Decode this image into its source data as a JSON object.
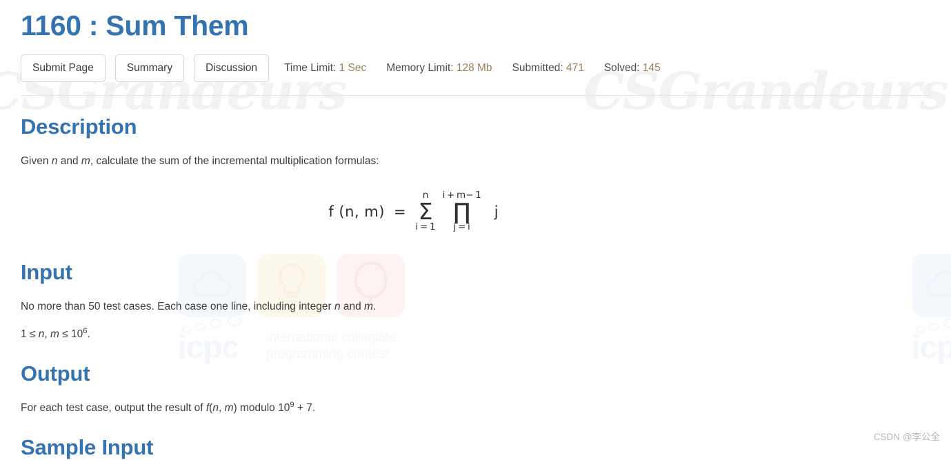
{
  "problem": {
    "title": "1160 : Sum Them"
  },
  "toolbar": {
    "buttons": [
      {
        "label": "Submit Page",
        "name": "submit-page-button"
      },
      {
        "label": "Summary",
        "name": "summary-button"
      },
      {
        "label": "Discussion",
        "name": "discussion-button"
      }
    ]
  },
  "stats": [
    {
      "label": "Time Limit:",
      "value": "1 Sec"
    },
    {
      "label": "Memory Limit:",
      "value": "128 Mb"
    },
    {
      "label": "Submitted:",
      "value": "471"
    },
    {
      "label": "Solved:",
      "value": "145"
    }
  ],
  "sections": {
    "description": {
      "heading": "Description",
      "intro_a": "Given ",
      "intro_var1": "n",
      "intro_b": " and ",
      "intro_var2": "m",
      "intro_c": ", calculate the sum of the incremental multiplication formulas:"
    },
    "input": {
      "heading": "Input",
      "line1_a": "No more than 50 test cases. Each case one line, including integer ",
      "line1_var1": "n",
      "line1_b": " and ",
      "line1_var2": "m",
      "line1_c": ".",
      "line2_a": "1 ≤ ",
      "line2_var1": "n",
      "line2_b": ", ",
      "line2_var2": "m",
      "line2_c": " ≤ 10",
      "line2_exp": "6",
      "line2_d": "."
    },
    "output": {
      "heading": "Output",
      "line_a": "For each test case, output the result of ",
      "line_fn": "f",
      "line_b": "(",
      "line_var1": "n",
      "line_c": ", ",
      "line_var2": "m",
      "line_d": ") modulo 10",
      "line_exp": "9",
      "line_e": " + 7."
    },
    "sample_input": {
      "heading": "Sample Input"
    }
  },
  "formula": {
    "function_name": "f (n, m)",
    "equals": "=",
    "sum": {
      "glyph": "Σ",
      "upper": "n",
      "lower": "i = 1"
    },
    "product": {
      "glyph": "∏",
      "upper": "i + m− 1",
      "lower": "j = i"
    },
    "variable": "j",
    "plain_text": "f(n, m) = Σ (i=1 to n) ∏ (j=i to i+m−1) j"
  },
  "watermarks": {
    "gothic_text": "CSGrandeurs",
    "icpc_word": "icpc",
    "icpc_sub_line1": "international collegiate",
    "icpc_sub_line2": "programming contest",
    "csdn": "CSDN @李公全"
  },
  "colors": {
    "heading_blue": "#3573b0",
    "stat_value": "#9b8058",
    "body_text": "#3d3d3d",
    "button_border": "#d5d5d5",
    "rule": "#e3e3e3"
  }
}
